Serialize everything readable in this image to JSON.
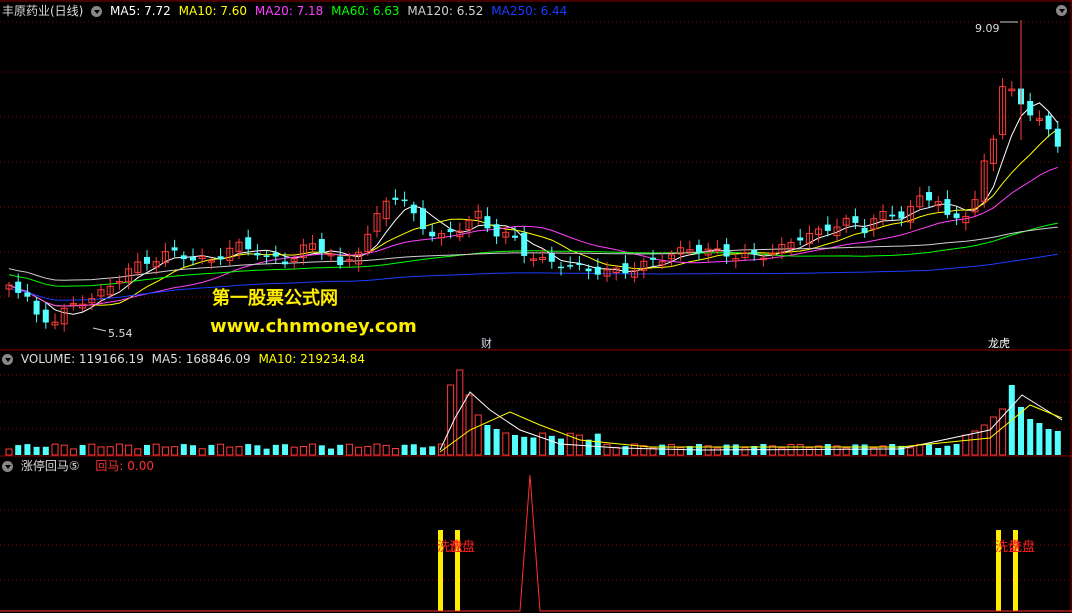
{
  "main_panel": {
    "title": "丰原药业(日线)",
    "indicators": [
      {
        "label": "MA5: 7.72",
        "color": "#ffffff"
      },
      {
        "label": "MA10: 7.60",
        "color": "#ffff00"
      },
      {
        "label": "MA20: 7.18",
        "color": "#ff40ff"
      },
      {
        "label": "MA60: 6.63",
        "color": "#00ff00"
      },
      {
        "label": "MA120: 6.52",
        "color": "#d0d0d0"
      },
      {
        "label": "MA250: 6.44",
        "color": "#1a3cff"
      }
    ],
    "high_label": "9.09",
    "low_label": "5.54",
    "marker_cai": "财",
    "marker_longhu": "龙虎"
  },
  "watermark": {
    "line1": "第一股票公式网",
    "line2": "www.chnmoney.com"
  },
  "volume_panel": {
    "labels": [
      {
        "label": "VOLUME: 119166.19",
        "color": "#dddddd"
      },
      {
        "label": "MA5: 168846.09",
        "color": "#dddddd"
      },
      {
        "label": "MA10: 219234.84",
        "color": "#ffff00"
      }
    ]
  },
  "indicator_panel": {
    "title": "涨停回马⑤",
    "value_label": "回马: 0.00",
    "signal_text": "洗盘",
    "signal_text_overlap": "洗盘"
  },
  "colors": {
    "up": "#ff3b3b",
    "down": "#54ffff",
    "grid": "#8b0000",
    "bg": "#000000"
  }
}
